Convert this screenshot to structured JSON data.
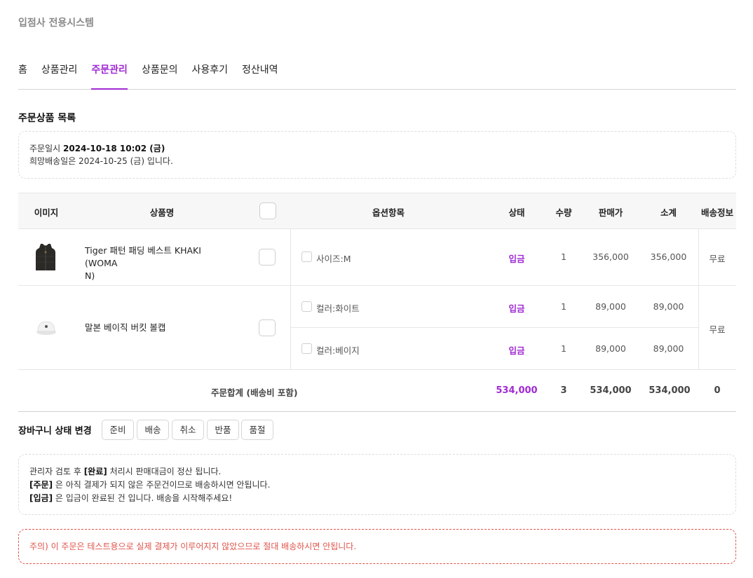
{
  "site": {
    "title": "입점사 전용시스템"
  },
  "nav": {
    "items": [
      {
        "label": "홈"
      },
      {
        "label": "상품관리"
      },
      {
        "label": "주문관리"
      },
      {
        "label": "상품문의"
      },
      {
        "label": "사용후기"
      },
      {
        "label": "정산내역"
      }
    ],
    "active": "주문관리"
  },
  "section": {
    "title": "주문상품 목록"
  },
  "order_info": {
    "date_label": "주문일시",
    "date_value": "2024-10-18 10:02 (금)",
    "delivery_note": "희망배송일은 2024-10-25 (금) 입니다."
  },
  "table": {
    "headers": {
      "image": "이미지",
      "name": "상품명",
      "options": "옵션항목",
      "status": "상태",
      "qty": "수량",
      "price": "판매가",
      "subtotal": "소계",
      "shipping": "배송정보"
    },
    "products": [
      {
        "name": "Tiger 패턴 패딩 베스트 KHAKI (WOMAN)",
        "name_line1": "Tiger 패턴 패딩 베스트 KHAKI (WOMA",
        "name_line2": "N)",
        "image": "vest-image",
        "shipping": "무료",
        "options": [
          {
            "label": "사이즈:M",
            "status": "입금",
            "qty": "1",
            "price": "356,000",
            "subtotal": "356,000"
          }
        ]
      },
      {
        "name": "말본 베이직 버킷 볼캡",
        "image": "cap-image",
        "shipping": "무료",
        "options": [
          {
            "label": "컬러:화이트",
            "status": "입금",
            "qty": "1",
            "price": "89,000",
            "subtotal": "89,000"
          },
          {
            "label": "컬러:베이지",
            "status": "입금",
            "qty": "1",
            "price": "89,000",
            "subtotal": "89,000"
          }
        ]
      }
    ],
    "total": {
      "label": "주문합계 (배송비 포함)",
      "amount": "534,000",
      "qty": "3",
      "price": "534,000",
      "subtotal": "534,000",
      "shipping": "0"
    }
  },
  "cart_status": {
    "label": "장바구니 상태 변경",
    "buttons": [
      "준비",
      "배송",
      "취소",
      "반품",
      "품절"
    ]
  },
  "guide": {
    "line1_pre": "관리자 검토 후 ",
    "line1_bold": "[완료]",
    "line1_post": " 처리시 판매대금이 정산 됩니다.",
    "line2_bold": "[주문]",
    "line2_post": " 은 아직 결제가 되지 않은 주문건이므로 배송하시면 안됩니다.",
    "line3_bold": "[입금]",
    "line3_post": " 은 입금이 완료된 건 입니다. 배송을 시작해주세요!"
  },
  "warning": {
    "text": "주의) 이 주문은 테스트용으로 실제 결제가 이루어지지 않았으므로 절대 배송하시면 안됩니다."
  },
  "colors": {
    "accent": "#a02ad4",
    "warning": "#e0534a",
    "header_bg": "#f7f7f7"
  }
}
